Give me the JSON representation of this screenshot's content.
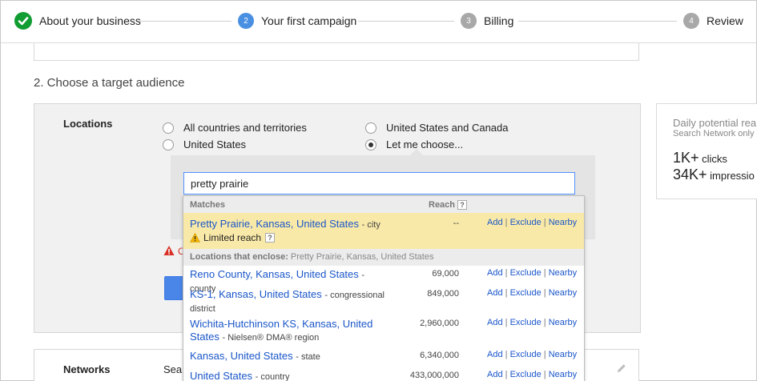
{
  "stepper": {
    "steps": [
      {
        "number": "",
        "label": "About your business",
        "state": "done"
      },
      {
        "number": "2",
        "label": "Your first campaign",
        "state": "active"
      },
      {
        "number": "3",
        "label": "Billing",
        "state": "todo"
      },
      {
        "number": "4",
        "label": "Review",
        "state": "todo"
      }
    ]
  },
  "section": {
    "title": "2. Choose a target audience"
  },
  "locations": {
    "label": "Locations",
    "options": [
      {
        "label": "All countries and territories",
        "selected": false
      },
      {
        "label": "United States and Canada",
        "selected": false
      },
      {
        "label": "United States",
        "selected": false
      },
      {
        "label": "Let me choose...",
        "selected": true
      }
    ],
    "search_value": "pretty prairie",
    "error_fragment": "C"
  },
  "dropdown": {
    "header_matches": "Matches",
    "header_reach": "Reach",
    "help_mark": "?",
    "limited_reach": "Limited reach",
    "enclose_label": "Locations that enclose:",
    "enclose_value": "Pretty Prairie, Kansas, United States",
    "action_add": "Add",
    "action_exclude": "Exclude",
    "action_nearby": "Nearby",
    "separator": "|",
    "rows": [
      {
        "name": "Pretty Prairie, Kansas, United States",
        "type": "city",
        "reach": "--"
      },
      {
        "name": "Reno County, Kansas, United States",
        "type": "county",
        "reach": "69,000"
      },
      {
        "name": "KS-1, Kansas, United States",
        "type": "congressional district",
        "reach": "849,000"
      },
      {
        "name": "Wichita-Hutchinson KS, Kansas, United States",
        "type": "Nielsen® DMA® region",
        "reach": "2,960,000"
      },
      {
        "name": "Kansas, United States",
        "type": "state",
        "reach": "6,340,000"
      },
      {
        "name": "United States",
        "type": "country",
        "reach": "433,000,000"
      }
    ]
  },
  "networks": {
    "label": "Networks",
    "value_fragment": "Sea"
  },
  "potential_reach": {
    "title": "Daily potential rea",
    "subtitle": "Search Network only",
    "clicks_value": "1K+",
    "clicks_label": "clicks",
    "impressions_value": "34K+",
    "impressions_label": "impressio"
  },
  "colors": {
    "accent_blue": "#4a90e2",
    "done_green": "#109d32",
    "link_blue": "#1a56c9",
    "highlight": "#f9e9a8",
    "warning_red": "#d93025"
  }
}
